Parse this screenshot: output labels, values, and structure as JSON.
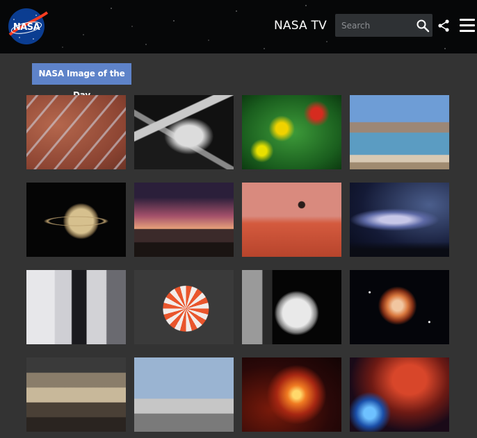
{
  "header": {
    "logo_text": "NASA",
    "title": "NASA TV",
    "search": {
      "placeholder": "Search",
      "value": ""
    },
    "icons": {
      "search": "search-icon",
      "share": "share-icon",
      "menu": "hamburger-menu-icon"
    }
  },
  "section": {
    "badge": "NASA Image of the Day"
  },
  "colors": {
    "header_bg": "#060708",
    "page_bg": "#333333",
    "badge_bg": "#5e83c9",
    "nasa_blue": "#0b3d91",
    "nasa_red": "#fc3d21"
  },
  "gallery": {
    "columns": 4,
    "rows": 4,
    "tiles": [
      "mars-frosted-dunes",
      "astronaut-spacewalk-robotic-arm",
      "green-nebula-infrared",
      "lake-and-mountains",
      "saturn-rings",
      "shuttle-on-aircraft-sunset",
      "mars-helicopter-illustration",
      "andromeda-milky-way-sky",
      "engineers-in-lab",
      "parachute-test",
      "astronaut-spacewalk-station",
      "planetary-nebula",
      "assembly-facility-interior",
      "astronaut-with-t38-jet",
      "red-supergiant-star",
      "nebula-cluster-hubble"
    ]
  }
}
